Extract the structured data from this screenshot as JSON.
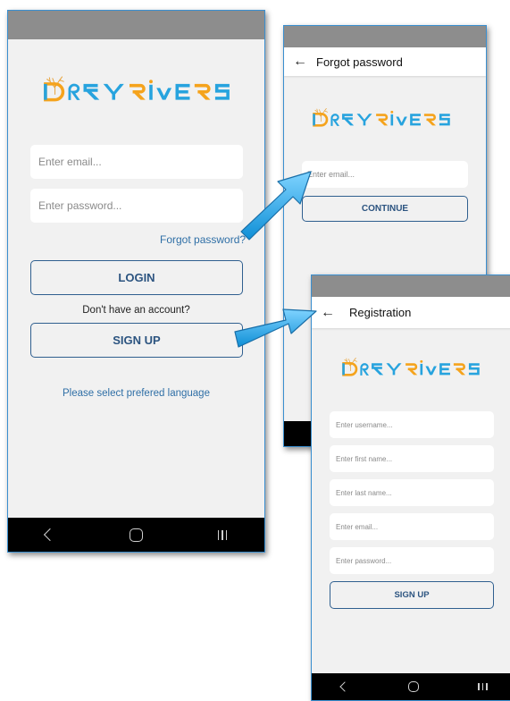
{
  "brand": {
    "name": "DRYRIVERS",
    "colors": {
      "orange": "#f5a31c",
      "blue": "#27a3de",
      "tree": "#e8a33a"
    }
  },
  "login": {
    "email_placeholder": "Enter email...",
    "password_placeholder": "Enter password...",
    "forgot_link": "Forgot password?",
    "login_button": "LOGIN",
    "no_account_text": "Don't have an account?",
    "signup_button": "SIGN UP",
    "language_link": "Please select prefered language"
  },
  "forgot": {
    "back_icon": "arrow-left-icon",
    "title": "Forgot password",
    "email_placeholder": "Enter email...",
    "continue_button": "CONTINUE"
  },
  "registration": {
    "back_icon": "arrow-left-icon",
    "title": "Registration",
    "username_placeholder": "Enter username...",
    "first_name_placeholder": "Enter first name...",
    "last_name_placeholder": "Enter last name...",
    "email_placeholder": "Enter email...",
    "password_placeholder": "Enter password...",
    "signup_button": "SIGN UP"
  },
  "nav_icons": [
    "back-icon",
    "home-icon",
    "recent-apps-icon"
  ],
  "arrow_color": "#1fa7e6"
}
